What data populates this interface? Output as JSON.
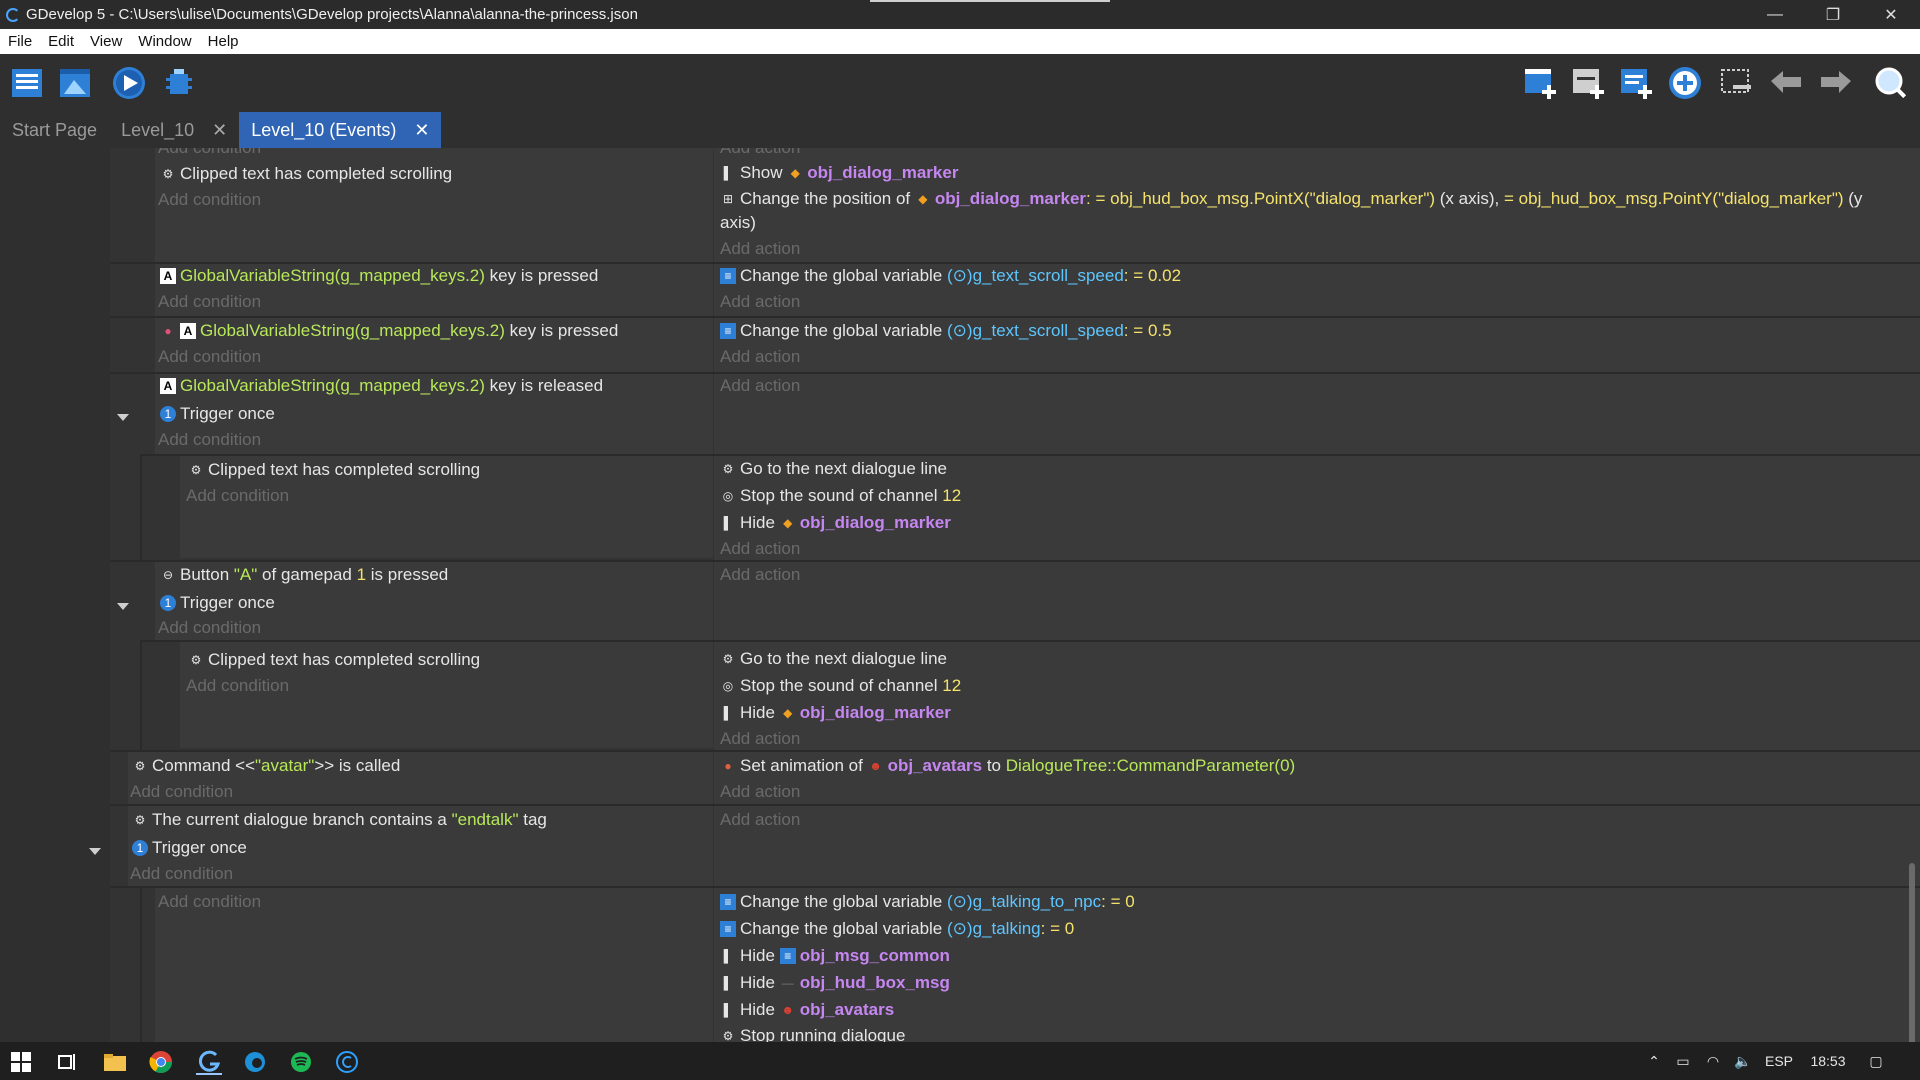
{
  "window": {
    "title": "GDevelop 5 - C:\\Users\\ulise\\Documents\\GDevelop projects\\Alanna\\alanna-the-princess.json",
    "minimize": "—",
    "maximize": "❐",
    "close": "✕"
  },
  "menu": {
    "file": "File",
    "edit": "Edit",
    "view": "View",
    "window": "Window",
    "help": "Help"
  },
  "tabs": [
    {
      "label": "Start Page"
    },
    {
      "label": "Level_10",
      "close": "✕"
    },
    {
      "label": "Level_10 (Events)",
      "close": "✕"
    }
  ],
  "add_condition": "Add condition",
  "add_action": "Add action",
  "events": {
    "e1": {
      "cond1": "Clipped text has completed scrolling",
      "act1": {
        "verb": "Show",
        "obj": "obj_dialog_marker"
      },
      "act2": {
        "verb": "Change the position of",
        "obj": "obj_dialog_marker",
        "sep1": ":",
        "eq1": "=",
        "expr1": "obj_hud_box_msg.PointX(\"dialog_marker\")",
        "axis1": "(x axis),",
        "eq2": "=",
        "expr2": "obj_hud_box_msg.PointY(\"dialog_marker\")",
        "axis2a": "(y",
        "axis2b": "axis)"
      }
    },
    "e2": {
      "cond_expr": "GlobalVariableString(g_mapped_keys.2)",
      "cond_tail": "key is pressed",
      "act_text": "Change the global variable",
      "act_var": "g_text_scroll_speed",
      "act_colon": ":",
      "act_eq": "=",
      "act_value": "0.02"
    },
    "e3": {
      "cond_expr": "GlobalVariableString(g_mapped_keys.2)",
      "cond_tail": "key is pressed",
      "act_text": "Change the global variable",
      "act_var": "g_text_scroll_speed",
      "act_colon": ":",
      "act_eq": "=",
      "act_value": "0.5"
    },
    "e4": {
      "cond_expr": "GlobalVariableString(g_mapped_keys.2)",
      "cond_tail": "key is released",
      "cond2": "Trigger once",
      "sub": {
        "cond1": "Clipped text has completed scrolling",
        "act1": "Go to the next dialogue line",
        "act2": "Stop the sound of channel",
        "act2_val": "12",
        "act3_verb": "Hide",
        "act3_obj": "obj_dialog_marker"
      }
    },
    "e5": {
      "cond1_a": "Button",
      "cond1_btn": "\"A\"",
      "cond1_b": "of gamepad",
      "cond1_pad": "1",
      "cond1_c": "is pressed",
      "cond2": "Trigger once",
      "sub": {
        "cond1": "Clipped text has completed scrolling",
        "act1": "Go to the next dialogue line",
        "act2": "Stop the sound of channel",
        "act2_val": "12",
        "act3_verb": "Hide",
        "act3_obj": "obj_dialog_marker"
      }
    },
    "e6": {
      "cond_a": "Command <<",
      "cond_q": "\"avatar\"",
      "cond_b": ">> is called",
      "act_a": "Set animation of",
      "act_obj": "obj_avatars",
      "act_to": "to",
      "act_expr": "DialogueTree::CommandParameter(0)"
    },
    "e7": {
      "cond_a": "The current dialogue branch contains a",
      "cond_q": "\"endtalk\"",
      "cond_b": "tag",
      "cond2": "Trigger once",
      "sub": {
        "act1_text": "Change the global variable",
        "act1_var": "g_talking_to_npc",
        "act1_colon": ":",
        "act1_eq": "=",
        "act1_val": "0",
        "act2_text": "Change the global variable",
        "act2_var": "g_talking",
        "act2_colon": ":",
        "act2_eq": "=",
        "act2_val": "0",
        "act3_verb": "Hide",
        "act3_obj": "obj_msg_common",
        "act4_verb": "Hide",
        "act4_obj": "obj_hud_box_msg",
        "act5_verb": "Hide",
        "act5_obj": "obj_avatars",
        "act6": "Stop running dialogue"
      }
    }
  },
  "taskbar": {
    "lang": "ESP",
    "time": "18:53"
  },
  "colors": {
    "tab_active": "#3064b4",
    "variable": "#5ec6ff",
    "object": "#c586f0",
    "expression": "#b8e85a",
    "number": "#f4e26c"
  }
}
